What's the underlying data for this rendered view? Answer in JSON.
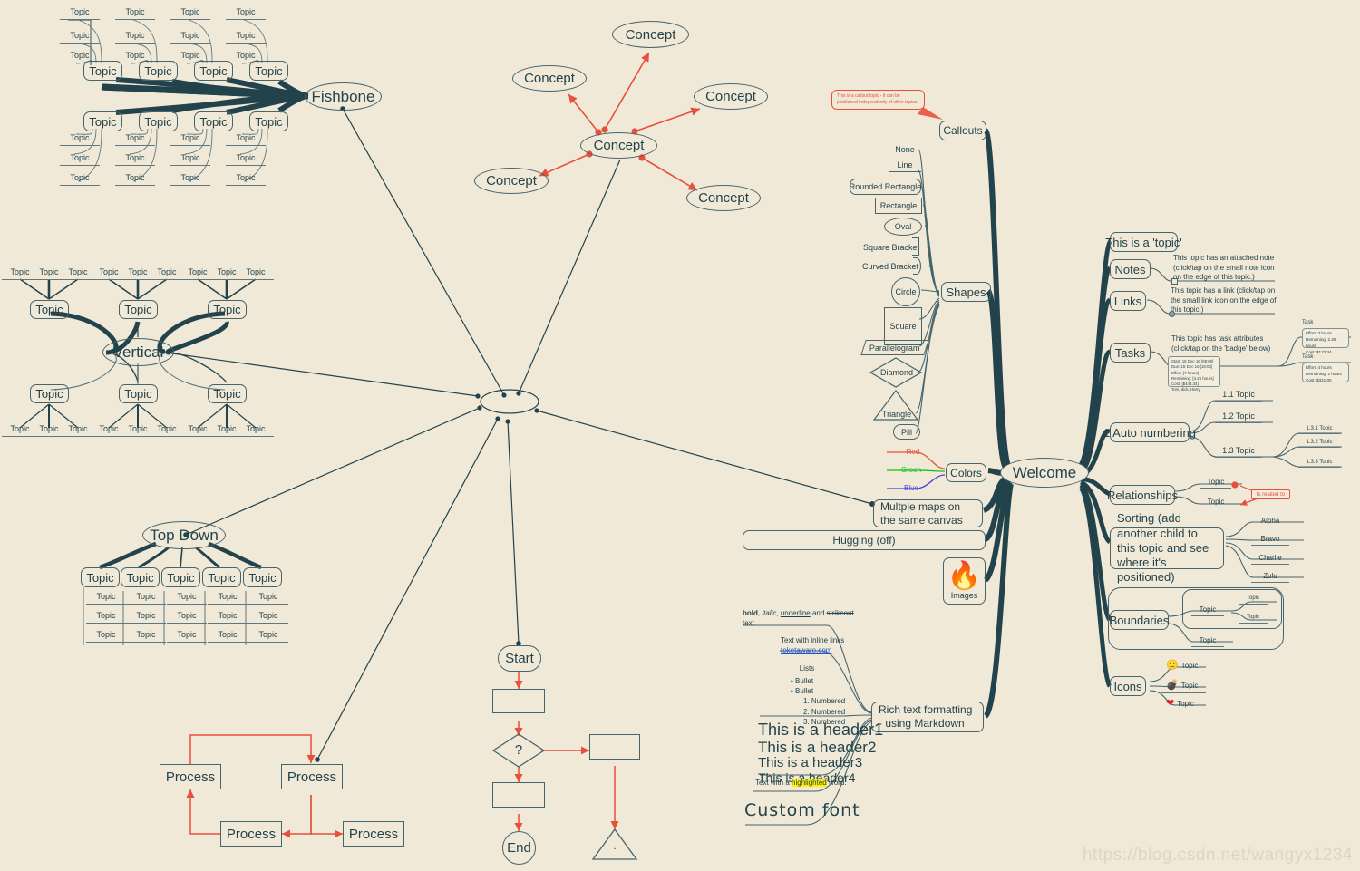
{
  "canvas": {
    "background": "#f0e9d8",
    "line_color": "#23434c",
    "accent_red": "#e8503a"
  },
  "center": {
    "label": ""
  },
  "watermark": {
    "text": "https://blog.csdn.net/wangyx1234"
  },
  "fishbone": {
    "root": "Fishbone",
    "spine_topic": "Topic",
    "leaf_topic": "Topic"
  },
  "vertical": {
    "root": "Vertical",
    "topic": "Topic"
  },
  "topdown": {
    "root": "Top Down",
    "topic": "Topic"
  },
  "concepts": {
    "center": "Concept",
    "outer": [
      "Concept",
      "Concept",
      "Concept",
      "Concept",
      "Concept"
    ]
  },
  "process": {
    "nodes": [
      "Process",
      "Process",
      "Process",
      "Process"
    ]
  },
  "flowchart": {
    "start": "Start",
    "end": "End",
    "decision": "?",
    "dot": "."
  },
  "welcome": {
    "root": "Welcome",
    "branches": {
      "callouts": {
        "label": "Callouts",
        "callout_text": "This is a callout topic - it can be positioned independently of other topics."
      },
      "shapes": {
        "label": "Shapes",
        "items": [
          "None",
          "Line",
          "Rounded Rectangle",
          "Rectangle",
          "Oval",
          "Square Bracket",
          "Curved Bracket",
          "Circle",
          "Square",
          "Parallelogram",
          "Diamond",
          "Triangle",
          "Pill"
        ]
      },
      "colors": {
        "label": "Colors",
        "items": [
          {
            "label": "Red",
            "color": "#e8503a"
          },
          {
            "label": "Green",
            "color": "#17c017"
          },
          {
            "label": "Blue",
            "color": "#4b3fe0"
          }
        ]
      },
      "multiple_maps": {
        "label": "Multple maps on the same canvas"
      },
      "hugging": {
        "label": "Hugging (off)"
      },
      "images": {
        "label": "Images",
        "icon": "fire-emoji"
      },
      "rich_text": {
        "label": "Rich text formatting - using Markdown",
        "children": {
          "styles": {
            "bold": "bold",
            "sep1": ", ",
            "italic": "italic",
            "sep2": ", ",
            "underline": "underline",
            "sep3": " and ",
            "strike": "strikeout",
            "tail": " text"
          },
          "inline_links": {
            "label": "Text with inline links",
            "link": "toketaware.com"
          },
          "lists": {
            "label": "Lists",
            "bullets": [
              "Bullet",
              "Bullet"
            ],
            "numbered": [
              "1. Numbered",
              "2. Numbered",
              "3. Numbered"
            ]
          },
          "headers": [
            "This is a header1",
            "This is a header2",
            "This is a header3",
            "This is a header4"
          ],
          "highlight": {
            "pre": "Text with a ",
            "word": "highlighted",
            "post": " word."
          },
          "custom_font": "Custom font"
        }
      },
      "topic": {
        "label": "This is a 'topic'"
      },
      "notes": {
        "label": "Notes",
        "child": "This topic has an attached note (click/tap on the small note icon on the edge of this topic.)"
      },
      "links": {
        "label": "Links",
        "child": "This topic has a link (click/tap on the small link icon on the edge of this topic.)"
      },
      "tasks": {
        "label": "Tasks",
        "child": "This topic has task attributes (click/tap on the 'badge' below)",
        "badge": {
          "start": "Start: 15 Dec 16 [08:00]",
          "due": "Due: 15 Dec 16 [18:00]",
          "effort": "Effort: [7 hours]",
          "remaining": "Remaining: [4.25 hours]",
          "cost": "Cost: [$444.34]",
          "people": "Tom, dick, Harry"
        },
        "subtasks": [
          {
            "label": "Task",
            "effort": "Effort: 3 hours",
            "remaining": "Remaining: 2.25 hours",
            "cost": "Cost: $123.34"
          },
          {
            "label": "Task",
            "effort": "Effort: 4 hours",
            "remaining": "Remaining: 2 hours",
            "cost": "Cost: $321.00"
          }
        ]
      },
      "auto_numbering": {
        "label": "1 Auto numbering",
        "children": [
          "1.1 Topic",
          "1.2 Topic",
          "1.3 Topic"
        ],
        "grandchildren": [
          "1.3.1 Topic",
          "1.3.2 Topic",
          "1.3.3 Topic"
        ]
      },
      "relationships": {
        "label": "Relationships",
        "children": [
          "Topic",
          "Topic"
        ],
        "link_label": "Is related to"
      },
      "sorting": {
        "label": "Sorting (add another child to this topic and see where it's positioned)",
        "children": [
          "Alpha",
          "Bravo",
          "Charlie",
          "Zulu"
        ]
      },
      "boundaries": {
        "label": "Boundaries",
        "children": [
          "Topic",
          "Topic"
        ],
        "grandchildren": [
          "Topic",
          "Topic"
        ]
      },
      "icons": {
        "label": "Icons",
        "children": [
          {
            "icon": "smiley-icon",
            "glyph": "🙂",
            "label": "Topic"
          },
          {
            "icon": "bomb-icon",
            "glyph": "💣",
            "label": "Topic"
          },
          {
            "icon": "heart-icon",
            "glyph": "❤",
            "label": "Topic"
          }
        ]
      }
    }
  }
}
